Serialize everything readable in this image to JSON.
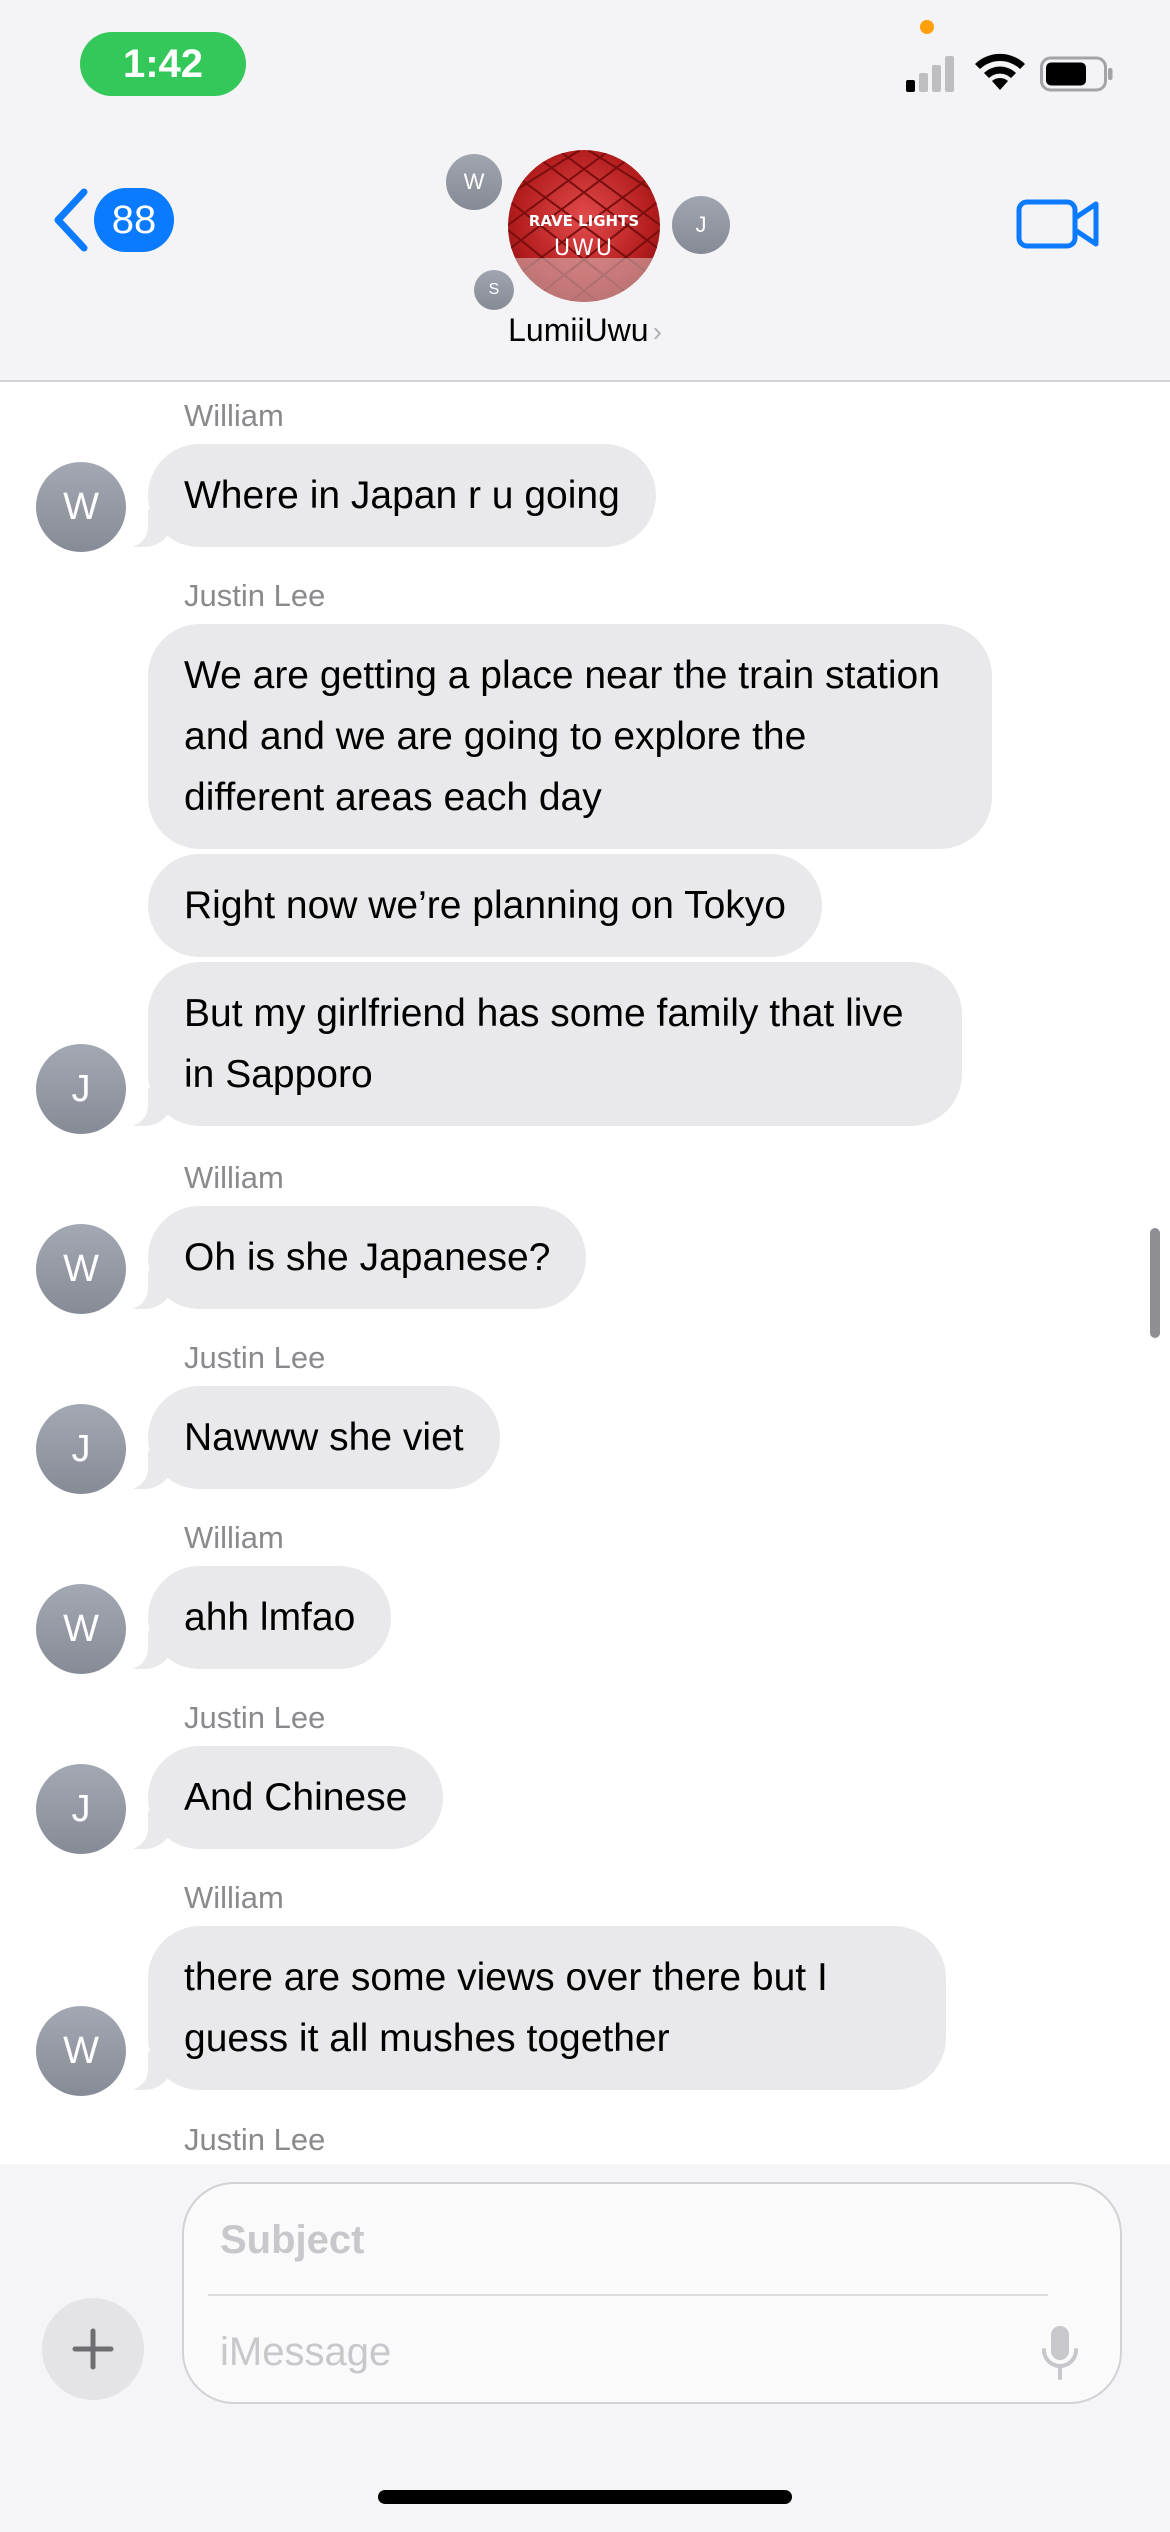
{
  "status_bar": {
    "time": "1:42"
  },
  "header": {
    "back_count": "88",
    "group_name": "LumiiUwu",
    "group_avatar_line1": "RAVE LIGHTS",
    "group_avatar_line2": "UWU",
    "participants": [
      "W",
      "J",
      "S"
    ],
    "accent_color": "#0a7aff"
  },
  "messages": [
    {
      "sender": "William",
      "initial": "W",
      "bubbles": [
        "Where in Japan r u going"
      ]
    },
    {
      "sender": "Justin Lee",
      "initial": "J",
      "bubbles": [
        "We are getting a place near the train station and and we are going to explore the different areas each day",
        "Right now we’re planning on Tokyo",
        "But my girlfriend has some family that live in Sapporo"
      ]
    },
    {
      "sender": "William",
      "initial": "W",
      "bubbles": [
        "Oh is she Japanese?"
      ]
    },
    {
      "sender": "Justin Lee",
      "initial": "J",
      "bubbles": [
        "Nawww she viet"
      ]
    },
    {
      "sender": "William",
      "initial": "W",
      "bubbles": [
        "ahh lmfao"
      ]
    },
    {
      "sender": "Justin Lee",
      "initial": "J",
      "bubbles": [
        "And Chinese"
      ]
    },
    {
      "sender": "William",
      "initial": "W",
      "bubbles": [
        "there are some views over there but I guess it all mushes together"
      ]
    },
    {
      "sender": "Justin Lee"
    }
  ],
  "compose": {
    "subject_placeholder": "Subject",
    "message_placeholder": "iMessage"
  },
  "icons": {
    "back": "chevron-left-icon",
    "video": "video-camera-icon",
    "add": "plus-icon",
    "mic": "microphone-icon"
  }
}
